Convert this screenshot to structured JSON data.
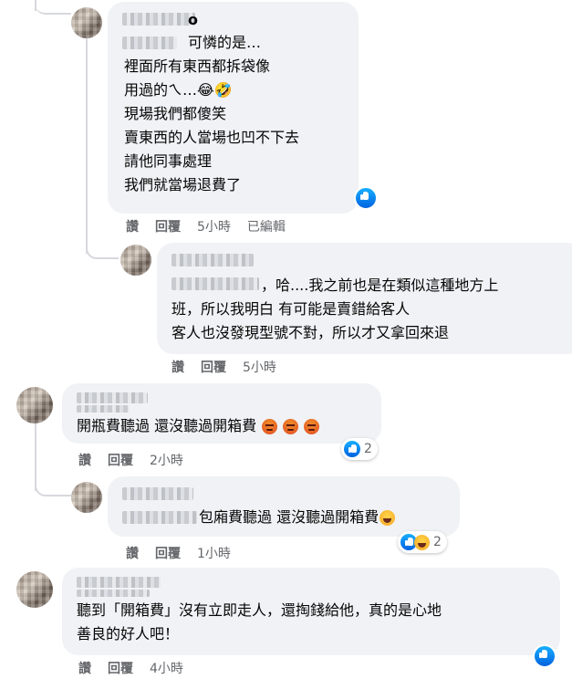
{
  "comments": [
    {
      "name_suffix": "o",
      "text": "可憐的是…\n裡面所有東西都拆袋像\n用過的ㄟ…😂🤣\n現場我們都傻笑\n賣東西的人當場也凹不下去\n請他同事處理\n我們就當場退費了",
      "actions": {
        "like": "讚",
        "reply": "回覆",
        "time": "5小時",
        "edited": "已編輯"
      }
    },
    {
      "text": "，哈....我之前也是在類似這種地方上\n班，所以我明白 有可能是賣錯給客人\n客人也沒發現型號不對，所以才又拿回來退",
      "actions": {
        "like": "讚",
        "reply": "回覆",
        "time": "5小時"
      }
    },
    {
      "text": "開瓶費聽過 還沒聽過開箱費",
      "reaction_count": "2",
      "actions": {
        "like": "讚",
        "reply": "回覆",
        "time": "2小時"
      }
    },
    {
      "text": "包廂費聽過 還沒聽過開箱費",
      "reaction_count": "2",
      "actions": {
        "like": "讚",
        "reply": "回覆",
        "time": "1小時"
      }
    },
    {
      "text": "聽到「開箱費」沒有立即走人，還掏錢給他，真的是心地\n善良的好人吧！",
      "actions": {
        "like": "讚",
        "reply": "回覆",
        "time": "4小時"
      }
    }
  ],
  "icons": {
    "like": "like-icon",
    "laugh": "laugh-emoji",
    "angry": "angry-emoji",
    "haha": "haha-emoji"
  },
  "colors": {
    "bubble": "#f0f2f5",
    "meta": "#65676b",
    "like_blue": "#1877f2"
  }
}
